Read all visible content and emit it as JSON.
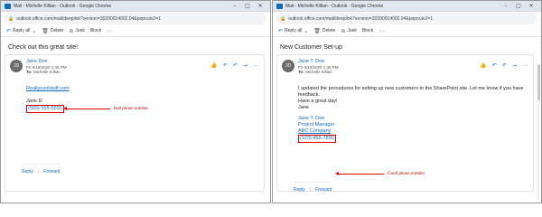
{
  "windows": [
    {
      "title": "Mail - Michelle Killian - Outlook - Google Chrome",
      "url": "outlook.office.com/mail/deeplink?version=20200914002.04&popoutv2=1",
      "toolbar": {
        "reply_all": "Reply all",
        "delete": "Delete",
        "junk": "Junk",
        "block": "Block"
      },
      "subject": "Check out this great site!",
      "avatar": "JD",
      "sender": "Jane Doe",
      "date": "Fri 9/18/2020 1:46 PM",
      "to_label": "To:",
      "to_name": "Michelle Killian",
      "body": {
        "link": "Reallycoolstuff.com",
        "sig_name": "Jane D",
        "phone": "(555) 555-5555"
      },
      "annotation": "Bad phone number",
      "reply": "Reply",
      "forward": "Forward"
    },
    {
      "title": "Mail - Michelle Killian - Outlook - Google Chrome",
      "url": "outlook.office.com/mail/deeplink?version=20200914002.04&popoutv2=1",
      "toolbar": {
        "reply_all": "Reply all",
        "delete": "Delete",
        "junk": "Junk",
        "block": "Block"
      },
      "subject": "New Customer Set-up",
      "avatar": "JD",
      "sender": "Jane T. Doe",
      "date": "Fri 9/18/2020 1:46 PM",
      "to_label": "To:",
      "to_name": "Michelle Killian",
      "body": {
        "paragraph": "I updated the procedures for setting up new customers to the SharePoint site. Let me know if you have feedback.",
        "closing": "Have a great day!",
        "short_name": "Jane",
        "sig_name": "Jane T. Doe",
        "sig_title": "Project Manager",
        "sig_company": "ABC Company",
        "phone": "(123) 456-7890"
      },
      "annotation": "Good phone number",
      "reply": "Reply",
      "forward": "Forward"
    }
  ],
  "colors": {
    "accent": "#0f6cbd",
    "annotation": "#e00000"
  }
}
